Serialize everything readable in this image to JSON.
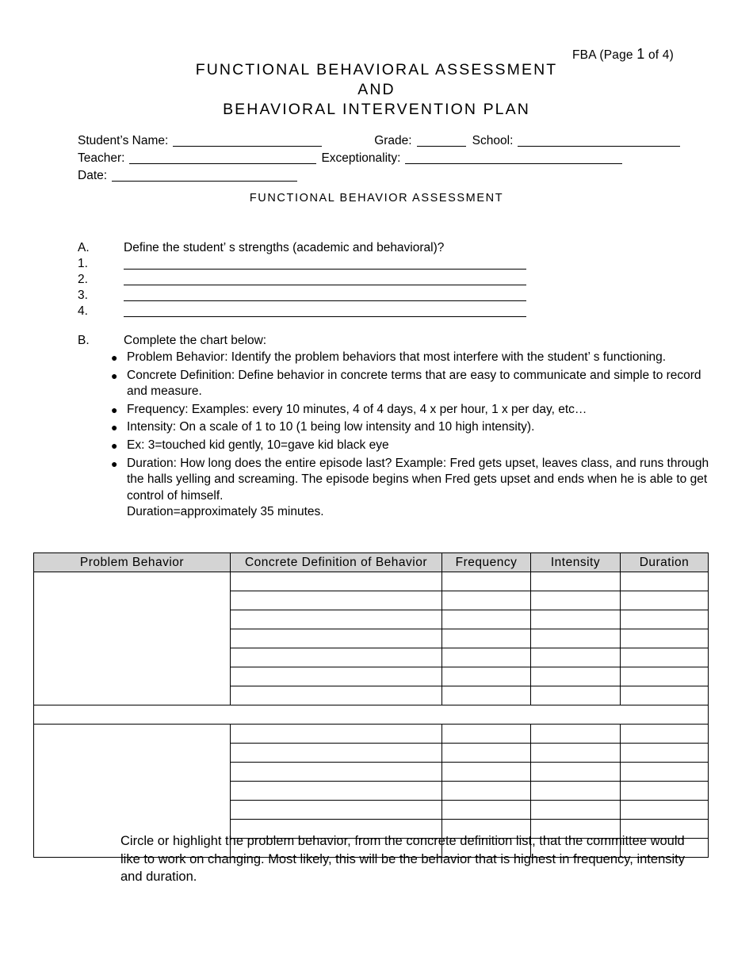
{
  "header": {
    "prefix": "FBA (Page ",
    "page_number": "1",
    "suffix": " of 4)"
  },
  "title": {
    "line1": "FUNCTIONAL BEHAVIORAL ASSESSMENT",
    "line2": "AND",
    "line3": "BEHAVIORAL INTERVENTION PLAN"
  },
  "section_title": "FUNCTIONAL BEHAVIOR ASSESSMENT",
  "info": {
    "student_name_label": "Student’s Name:",
    "grade_label": "Grade:",
    "school_label": "School:",
    "teacher_label": "Teacher:",
    "exceptionality_label": "Exceptionality:",
    "date_label": "Date:",
    "student_name_value": "",
    "grade_value": "",
    "school_value": "",
    "teacher_value": "",
    "exceptionality_value": "",
    "date_value": ""
  },
  "section_a": {
    "letter": "A.",
    "prompt": "Define the student’ s strengths (academic and behavioral)?",
    "items": [
      {
        "num": "1.",
        "value": ""
      },
      {
        "num": "2.",
        "value": ""
      },
      {
        "num": "3.",
        "value": ""
      },
      {
        "num": "4.",
        "value": ""
      }
    ]
  },
  "section_b": {
    "letter": "B.",
    "prompt": "Complete the chart below:",
    "bullets": [
      "Problem Behavior:  Identify the problem behaviors that most interfere with the student’ s functioning.",
      "Concrete Definition:  Define behavior in concrete terms that are easy to communicate and simple to record and measure.",
      "Frequency:  Examples:  every 10 minutes, 4 of 4 days, 4 x per hour, 1 x per day, etc…",
      "Intensity:  On a scale of 1 to 10 (1 being low intensity and 10 high intensity).",
      "Ex: 3=touched kid gently, 10=gave kid black eye",
      "Duration:  How long does the entire episode last?  Example:  Fred gets upset, leaves class, and runs through the halls yelling and screaming.  The episode begins when Fred gets upset and ends when he is able to get control of himself."
    ],
    "bullet_sub_line": "Duration=approximately 35 minutes."
  },
  "table": {
    "columns": [
      "Problem Behavior",
      "Concrete Definition of Behavior",
      "Frequency",
      "Intensity",
      "Duration"
    ],
    "block1": {
      "problem_behavior": "",
      "rows": [
        {
          "concrete_definition": "",
          "frequency": "",
          "intensity": "",
          "duration": ""
        },
        {
          "concrete_definition": "",
          "frequency": "",
          "intensity": "",
          "duration": ""
        },
        {
          "concrete_definition": "",
          "frequency": "",
          "intensity": "",
          "duration": ""
        },
        {
          "concrete_definition": "",
          "frequency": "",
          "intensity": "",
          "duration": ""
        },
        {
          "concrete_definition": "",
          "frequency": "",
          "intensity": "",
          "duration": ""
        },
        {
          "concrete_definition": "",
          "frequency": "",
          "intensity": "",
          "duration": ""
        },
        {
          "concrete_definition": "",
          "frequency": "",
          "intensity": "",
          "duration": ""
        }
      ]
    },
    "block2": {
      "problem_behavior": "",
      "rows": [
        {
          "concrete_definition": "",
          "frequency": "",
          "intensity": "",
          "duration": ""
        },
        {
          "concrete_definition": "",
          "frequency": "",
          "intensity": "",
          "duration": ""
        },
        {
          "concrete_definition": "",
          "frequency": "",
          "intensity": "",
          "duration": ""
        },
        {
          "concrete_definition": "",
          "frequency": "",
          "intensity": "",
          "duration": ""
        },
        {
          "concrete_definition": "",
          "frequency": "",
          "intensity": "",
          "duration": ""
        },
        {
          "concrete_definition": "",
          "frequency": "",
          "intensity": "",
          "duration": ""
        },
        {
          "concrete_definition": "",
          "frequency": "",
          "intensity": "",
          "duration": ""
        }
      ]
    }
  },
  "footnote": "Circle or highlight the problem behavior, from the concrete definition list, that the committee would like to work on changing.  Most likely, this will be the behavior that is highest in frequency, intensity and duration.",
  "colors": {
    "table_header_bg": "#d4d4d4",
    "rule": "#000000",
    "text": "#000000"
  }
}
